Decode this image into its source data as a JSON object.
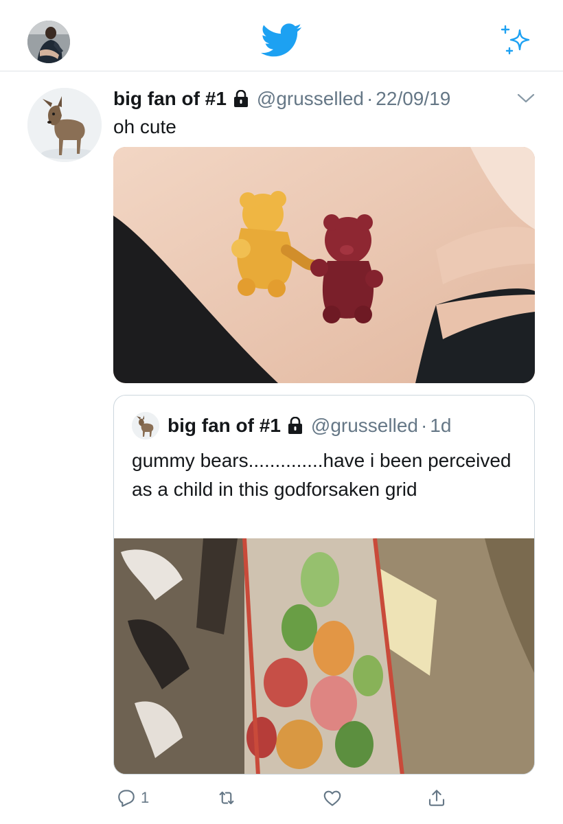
{
  "tweet": {
    "display_name": "big fan of #1",
    "handle": "@grusselled",
    "separator": "·",
    "timestamp": "22/09/19",
    "text": "oh cute",
    "reply_count": "1"
  },
  "quoted_tweet": {
    "display_name": "big fan of #1",
    "handle": "@grusselled",
    "separator": "·",
    "timestamp": "1d",
    "text": "gummy bears..............have i been perceived as a child in this godforsaken grid"
  },
  "icons": {
    "logo": "twitter-bird-icon",
    "top_right": "sparkle-icon",
    "protected": "lock-icon",
    "more": "chevron-down-icon",
    "reply": "reply-icon",
    "retweet": "retweet-icon",
    "like": "heart-icon",
    "share": "share-icon"
  },
  "colors": {
    "brand_blue": "#1da1f2",
    "secondary_text": "#657786",
    "divider": "#dfe3e6"
  }
}
